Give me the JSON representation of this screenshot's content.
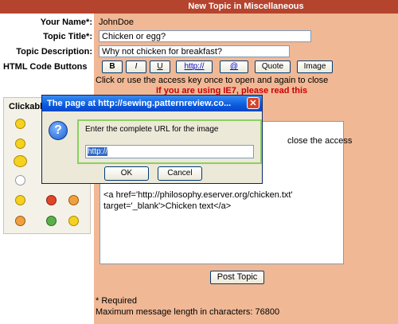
{
  "header": {
    "title": "New Topic in Miscellaneous"
  },
  "form": {
    "name_label": "Your Name*:",
    "name_value": "JohnDoe",
    "title_label": "Topic Title*:",
    "title_value": "Chicken or egg?",
    "desc_label": "Topic Description:",
    "desc_value": "Why not chicken for breakfast?",
    "html_buttons_label": "HTML Code Buttons"
  },
  "toolbar": {
    "bold": "B",
    "italic": "I",
    "underline": "U",
    "link": "http://",
    "email": "@",
    "quote": "Quote",
    "image": "Image"
  },
  "hints": {
    "access": "Click or use the access key once to open and again to close",
    "ie7_warning": "If you are using IE7, please read this"
  },
  "smilies": {
    "title": "Clickable"
  },
  "message": {
    "line_right": "close the access",
    "line1": "<a href='http://philosophy.eserver.org/chicken.txt'",
    "line2": "target='_blank'>Chicken text</a>"
  },
  "submit": {
    "label": "Post Topic"
  },
  "footer": {
    "required": "* Required",
    "max_length": "Maximum message length in characters: 76800"
  },
  "dialog": {
    "title": "The page at http://sewing.patternreview.co...",
    "close": "✕",
    "prompt": "Enter the complete URL for the image",
    "input_value": "http://",
    "ok": "OK",
    "cancel": "Cancel"
  },
  "colors": {
    "header_bg": "#b5442e",
    "panel_bg": "#f0b895",
    "warning": "#cc0000",
    "dialog_title": "#0a5be0"
  }
}
